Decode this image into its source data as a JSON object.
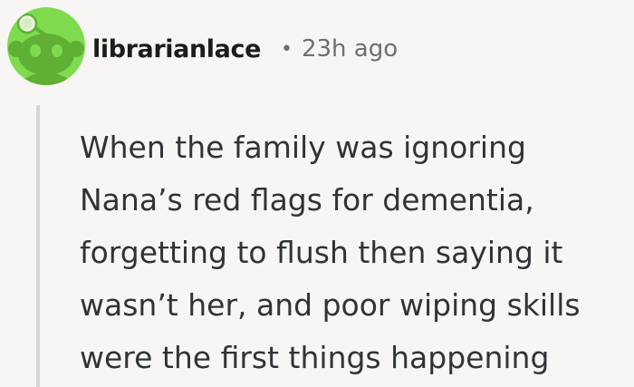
{
  "comment": {
    "author": "librarianlace",
    "separator": "•",
    "timestamp": "23h ago",
    "avatar_icon": "reddit-snoo-avatar-icon",
    "colors": {
      "avatar_bg": "#7edb4e",
      "text": "#2f3438",
      "muted": "#6a6f73",
      "thread_line": "#d7d6d3",
      "background": "#f7f6f4"
    },
    "body_lines": [
      "When the family was ignoring",
      "Nana’s red flags for dementia,",
      "forgetting to flush then saying it",
      "wasn’t her, and poor wiping skills",
      "were the first things happening"
    ]
  }
}
